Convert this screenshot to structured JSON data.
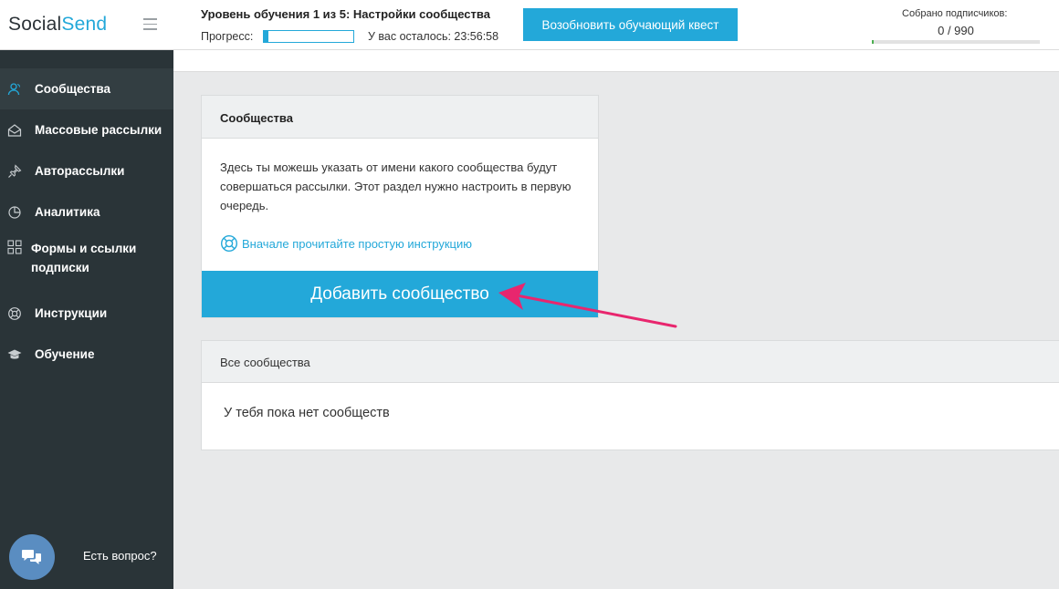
{
  "app": {
    "logo_part1": "Social",
    "logo_part2": "Send"
  },
  "tutorial": {
    "level_title": "Уровень обучения 1 из 5: Настройки сообщества",
    "progress_label": "Прогресс:",
    "progress_percent": 5,
    "time_left": "У вас осталось: 23:56:58",
    "resume_button": "Возобновить обучающий квест"
  },
  "subscribers": {
    "label": "Собрано подписчиков:",
    "count": "0 / 990",
    "progress_fraction": 0.01
  },
  "sidebar": {
    "items": [
      {
        "label": "Сообщества",
        "icon": "users-icon"
      },
      {
        "label": "Массовые рассылки",
        "icon": "envelope-icon"
      },
      {
        "label": "Авторассылки",
        "icon": "pin-icon"
      },
      {
        "label": "Аналитика",
        "icon": "pie-chart-icon"
      },
      {
        "label": "Формы и ссылки подписки",
        "icon": "grid-icon"
      },
      {
        "label": "Инструкции",
        "icon": "lifebuoy-icon"
      },
      {
        "label": "Обучение",
        "icon": "graduation-cap-icon"
      }
    ],
    "chat_label": "Есть вопрос?"
  },
  "communities_card": {
    "title": "Сообщества",
    "description": "Здесь ты можешь указать от имени какого сообщества будут совершаться рассылки. Этот раздел нужно настроить в первую очередь.",
    "instruction_link": "Вначале прочитайте простую инструкцию",
    "add_button": "Добавить сообщество"
  },
  "all_communities_card": {
    "title": "Все сообщества",
    "empty_text": "У тебя пока нет сообществ"
  },
  "colors": {
    "accent": "#23a8d9",
    "sidebar": "#2a3438",
    "arrow": "#e8266e"
  }
}
